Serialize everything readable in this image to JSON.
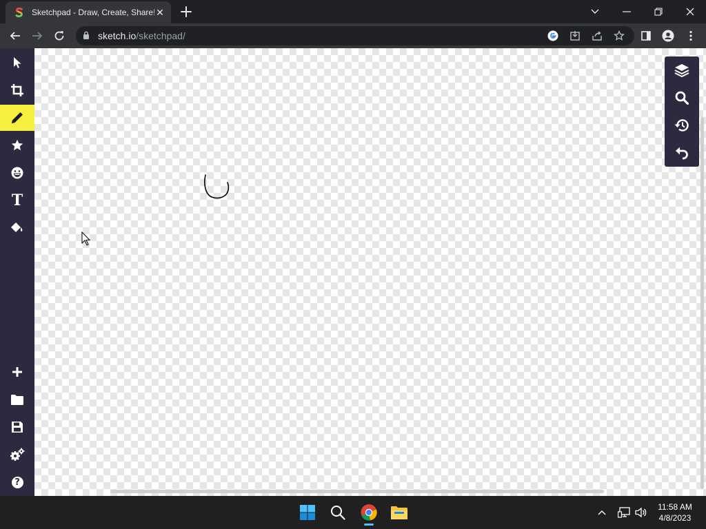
{
  "browser": {
    "tab": {
      "title": "Sketchpad - Draw, Create, Share!",
      "favicon": "sketchpad-s-icon"
    },
    "address": {
      "host": "sketch.io",
      "path": "/sketchpad/"
    },
    "nav_icons": [
      "back-arrow-icon",
      "forward-arrow-icon",
      "reload-icon"
    ],
    "omnibox_icons": [
      "google-icon",
      "install-icon",
      "share-icon",
      "bookmark-star-icon"
    ],
    "toolbar_icons": [
      "side-panel-icon",
      "profile-icon",
      "menu-dots-icon"
    ],
    "window_controls": [
      "tab-search-chevron-icon",
      "minimize-icon",
      "restore-icon",
      "close-icon"
    ]
  },
  "sketchpad": {
    "tools_top": [
      {
        "name": "select",
        "icon": "pointer-icon",
        "active": false
      },
      {
        "name": "crop",
        "icon": "crop-icon",
        "active": false
      },
      {
        "name": "pencil",
        "icon": "pencil-icon",
        "active": true
      },
      {
        "name": "stamp",
        "icon": "star-icon",
        "active": false
      },
      {
        "name": "emoji",
        "icon": "emoji-icon",
        "active": false
      },
      {
        "name": "text",
        "icon": "text-t-icon",
        "text": "T",
        "active": false
      },
      {
        "name": "fill",
        "icon": "paint-bucket-icon",
        "active": false
      }
    ],
    "tools_bottom": [
      {
        "name": "new",
        "icon": "plus-icon"
      },
      {
        "name": "open",
        "icon": "folder-icon"
      },
      {
        "name": "save",
        "icon": "save-icon"
      },
      {
        "name": "settings",
        "icon": "gears-icon"
      },
      {
        "name": "help",
        "icon": "help-icon",
        "text": "?"
      }
    ],
    "right_panel": [
      {
        "name": "layers",
        "icon": "layers-icon"
      },
      {
        "name": "zoom",
        "icon": "magnifier-icon"
      },
      {
        "name": "history",
        "icon": "history-icon"
      },
      {
        "name": "undo",
        "icon": "undo-icon"
      }
    ],
    "colors": {
      "sidebar": "#2b2a3f",
      "active_tool": "#f5ef3f",
      "stroke": "#000000"
    }
  },
  "taskbar": {
    "apps": [
      "windows-start-icon",
      "search-icon",
      "chrome-icon",
      "file-explorer-icon"
    ],
    "tray_icons": [
      "chevron-up-icon",
      "network-icon",
      "volume-icon"
    ],
    "time": "11:58 AM",
    "date": "4/8/2023"
  }
}
